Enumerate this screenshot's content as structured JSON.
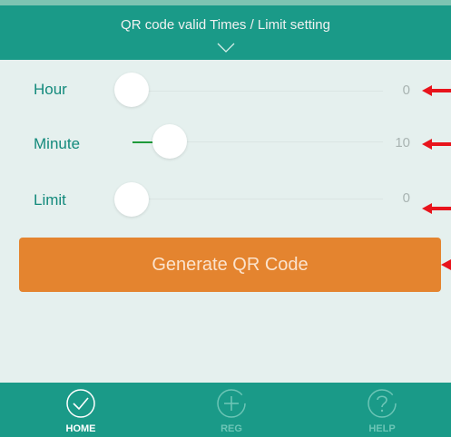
{
  "header": {
    "title": "QR code valid Times / Limit setting",
    "collapse_icon": "chevron-down-icon"
  },
  "settings": {
    "rows": [
      {
        "label": "Hour",
        "value": "0",
        "min": 0,
        "max": 23
      },
      {
        "label": "Minute",
        "value": "10",
        "min": 0,
        "max": 59
      },
      {
        "label": "Limit",
        "value": "0",
        "min": 0,
        "max": 10
      }
    ]
  },
  "generate_button": {
    "label": "Generate QR Code"
  },
  "bottom_nav": {
    "items": [
      {
        "label": "HOME",
        "icon": "check-circle-icon",
        "active": true
      },
      {
        "label": "REG",
        "icon": "plus-circle-icon",
        "active": false
      },
      {
        "label": "HELP",
        "icon": "help-circle-icon",
        "active": false
      }
    ]
  },
  "colors": {
    "header": "#1a9a88",
    "panel": "#e5f0ee",
    "label": "#138a7c",
    "button": "#e4842f",
    "slider_fill": "#1e9a3a",
    "annotation_arrow": "#e8141c"
  }
}
